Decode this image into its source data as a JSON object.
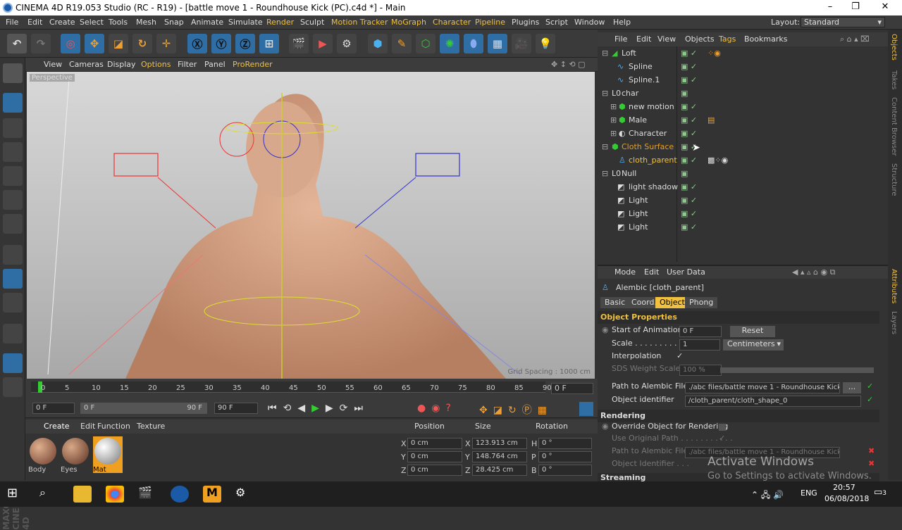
{
  "window": {
    "title": "CINEMA 4D R19.053 Studio (RC - R19) - [battle move 1 - Roundhouse Kick (PC).c4d *] - Main"
  },
  "menu": {
    "items": [
      "File",
      "Edit",
      "Create",
      "Select",
      "Tools",
      "Mesh",
      "Snap",
      "Animate",
      "Simulate",
      "Render",
      "Sculpt",
      "Motion Tracker",
      "MoGraph",
      "Character",
      "Pipeline",
      "Plugins",
      "Script",
      "Window",
      "Help"
    ],
    "layout_label": "Layout:",
    "layout_value": "Standard"
  },
  "viewport": {
    "menu": [
      "View",
      "Cameras",
      "Display",
      "Options",
      "Filter",
      "Panel",
      "ProRender"
    ],
    "label": "Perspective",
    "grid_spacing": "Grid Spacing : 1000 cm"
  },
  "timeline": {
    "ticks": [
      "0",
      "5",
      "10",
      "15",
      "20",
      "25",
      "30",
      "35",
      "40",
      "45",
      "50",
      "55",
      "60",
      "65",
      "70",
      "75",
      "80",
      "85",
      "90"
    ],
    "current_frame": "0 F",
    "start": "0 F",
    "slider_start": "0 F",
    "slider_end": "90 F",
    "end": "90 F"
  },
  "materials": {
    "menu": [
      "Create",
      "Edit",
      "Function",
      "Texture"
    ],
    "items": [
      {
        "name": "Body"
      },
      {
        "name": "Eyes"
      },
      {
        "name": "Mat"
      }
    ],
    "watermark": "MAXON CINEMA 4D"
  },
  "coords": {
    "headers": [
      "Position",
      "Size",
      "Rotation"
    ],
    "rows": [
      {
        "axis": "X",
        "pos": "0 cm",
        "size_axis": "X",
        "size": "123.913 cm",
        "rot_axis": "H",
        "rot": "0 °"
      },
      {
        "axis": "Y",
        "pos": "0 cm",
        "size_axis": "Y",
        "size": "148.764 cm",
        "rot_axis": "P",
        "rot": "0 °"
      },
      {
        "axis": "Z",
        "pos": "0 cm",
        "size_axis": "Z",
        "size": "28.425 cm",
        "rot_axis": "B",
        "rot": "0 °"
      }
    ]
  },
  "objects": {
    "menu": [
      "File",
      "Edit",
      "View",
      "Objects",
      "Tags",
      "Bookmarks"
    ],
    "rows": [
      {
        "name": "Loft"
      },
      {
        "name": "Spline"
      },
      {
        "name": "Spline.1"
      },
      {
        "name": "char"
      },
      {
        "name": "new motion"
      },
      {
        "name": "Male"
      },
      {
        "name": "Character"
      },
      {
        "name": "Cloth Surface"
      },
      {
        "name": "cloth_parent"
      },
      {
        "name": "Null"
      },
      {
        "name": "light shadow"
      },
      {
        "name": "Light"
      },
      {
        "name": "Light"
      },
      {
        "name": "Light"
      }
    ]
  },
  "attributes": {
    "menu": [
      "Mode",
      "Edit",
      "User Data"
    ],
    "object_title": "Alembic [cloth_parent]",
    "tabs": [
      "Basic",
      "Coord.",
      "Object",
      "Phong"
    ],
    "section1": "Object Properties",
    "start_label": "Start of Animation",
    "start_value": "0 F",
    "reset": "Reset",
    "scale_label": "Scale . . . . . . . . . . .",
    "scale_value": "1",
    "unit": "Centimeters",
    "interp_label": "Interpolation",
    "sds_label": "SDS Weight Scale",
    "sds_value": "100 %",
    "path_label": "Path to Alembic File",
    "path_value": "./abc files/battle move 1 - Roundhouse Kick C",
    "browse": "...",
    "ident_label": "Object identifier",
    "ident_value": "/cloth_parent/cloth_shape_0",
    "section2": "Rendering",
    "override_label": "Override Object for Rendering",
    "use_orig_label": "Use Original Path . . . . . . . . . . .",
    "path2_label": "Path to Alembic File",
    "path2_value": "./abc files/battle move 1 - Roundhouse Kick C",
    "ident2_label": "Object Identifier . . .",
    "section3": "Streaming"
  },
  "side_tabs": [
    "Objects",
    "Takes",
    "Content Browser",
    "Structure",
    "Attributes",
    "Layers"
  ],
  "activation": {
    "line1": "Activate Windows",
    "line2": "Go to Settings to activate Windows."
  },
  "taskbar": {
    "lang": "ENG",
    "time": "20:57",
    "date": "06/08/2018",
    "notif": "3"
  }
}
